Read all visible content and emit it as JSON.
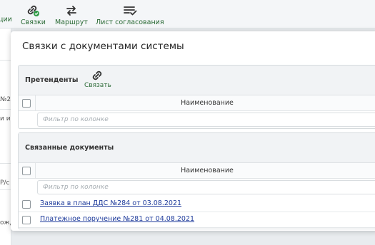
{
  "toolbar": {
    "partial_left": "ции",
    "links": "Связки",
    "route": "Маршрут",
    "approval_sheet": "Лист согласования"
  },
  "background": {
    "frag1": "№2",
    "frag2": "и и",
    "frag3": "Р/с",
    "frag4": "ожд"
  },
  "dialog": {
    "title": "Связки с документами системы",
    "candidates": {
      "title": "Претенденты",
      "link_button": "Связать",
      "column": "Наименование",
      "filter_placeholder": "Фильтр по колонке"
    },
    "linked": {
      "title": "Связанные документы",
      "column": "Наименование",
      "filter_placeholder": "Фильтр по колонке",
      "rows": [
        {
          "name": "Заявка в план ДДС №284 от 03.08.2021"
        },
        {
          "name": "Платежное поручение №281 от 04.08.2021"
        }
      ]
    }
  },
  "colors": {
    "accent_green": "#2a6a35",
    "link_blue": "#1f3c9c"
  },
  "icons": {
    "links": "link-check-icon",
    "route": "route-arrows-icon",
    "approval_sheet": "list-check-icon",
    "link_button": "link-icon"
  }
}
